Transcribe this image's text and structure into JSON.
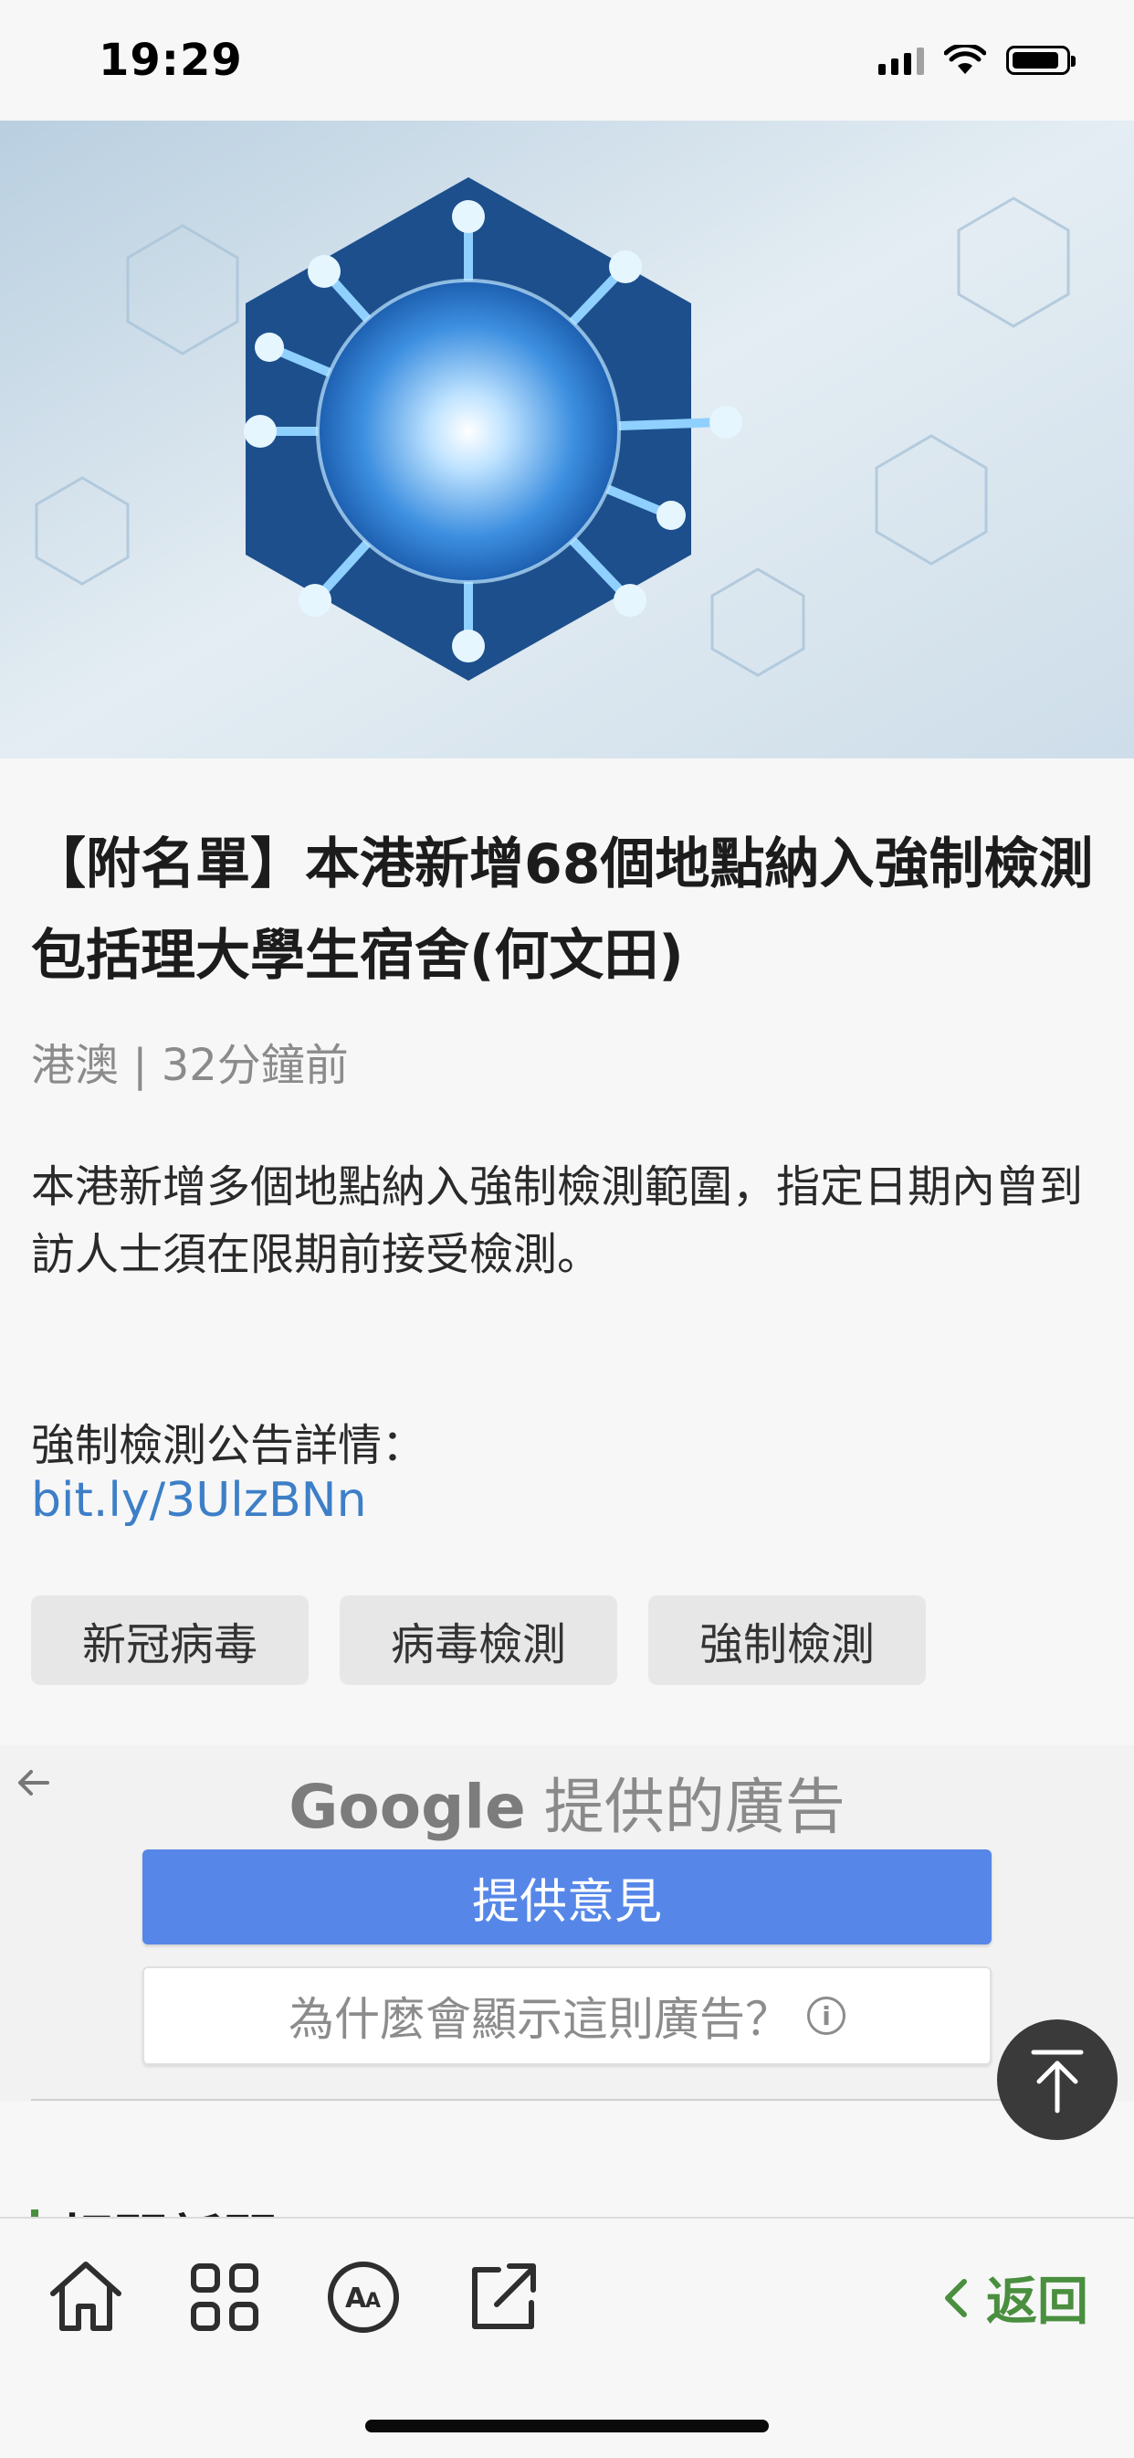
{
  "status_bar": {
    "time": "19:29",
    "icons": [
      "signal-icon",
      "wifi-icon",
      "battery-icon"
    ]
  },
  "hero": {
    "alt": "virus-hexagon-illustration"
  },
  "article": {
    "title": "【附名單】本港新增68個地點納入強制檢測 包括理大學生宿舍(何文田)",
    "category": "港澳",
    "separator": "|",
    "time_ago": "32分鐘前",
    "body": "本港新增多個地點納入強制檢測範圍，指定日期內曾到訪人士須在限期前接受檢測。",
    "notice_label": "強制檢測公告詳情：",
    "notice_link": "bit.ly/3UlzBNn",
    "tags": [
      "新冠病毒",
      "病毒檢測",
      "強制檢測"
    ]
  },
  "ad": {
    "back_icon": "arrow-left-icon",
    "google_word": "Google",
    "heading": "提供的廣告",
    "feedback_button": "提供意見",
    "why_button": "為什麼會顯示這則廣告？",
    "info_glyph": "i"
  },
  "next_section": {
    "heading": "相關新聞"
  },
  "toolbar": {
    "icons": [
      "home-icon",
      "grid-icon",
      "font-size-icon",
      "share-icon"
    ],
    "back_label": "返回"
  },
  "colors": {
    "accent_green": "#4a8f3f",
    "link_blue": "#3d7fc7",
    "ad_blue": "#5687e8"
  }
}
